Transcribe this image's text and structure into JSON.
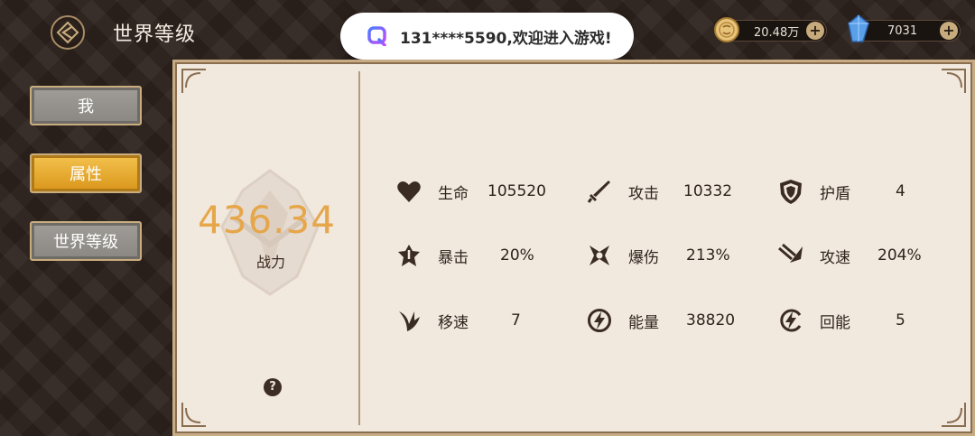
{
  "header": {
    "title": "世界等级",
    "toast_message": "131****5590,欢迎进入游戏!",
    "gold": "20.48万",
    "gems": "7031"
  },
  "sidebar": {
    "items": [
      {
        "label": "我",
        "active": false
      },
      {
        "label": "属性",
        "active": true
      },
      {
        "label": "世界等级",
        "active": false
      }
    ]
  },
  "power": {
    "value": "436.34",
    "label": "战力"
  },
  "stats": [
    {
      "icon": "heart-icon",
      "label": "生命",
      "value": "105520"
    },
    {
      "icon": "sword-icon",
      "label": "攻击",
      "value": "10332"
    },
    {
      "icon": "shield-icon",
      "label": "护盾",
      "value": "4"
    },
    {
      "icon": "crit-icon",
      "label": "暴击",
      "value": "20%"
    },
    {
      "icon": "crit-damage-icon",
      "label": "爆伤",
      "value": "213%"
    },
    {
      "icon": "attack-speed-icon",
      "label": "攻速",
      "value": "204%"
    },
    {
      "icon": "wing-icon",
      "label": "移速",
      "value": "7"
    },
    {
      "icon": "energy-icon",
      "label": "能量",
      "value": "38820"
    },
    {
      "icon": "energy-regen-icon",
      "label": "回能",
      "value": "5"
    }
  ],
  "colors": {
    "accent_gold": "#e6a64a",
    "panel_bg": "#f1e8de",
    "active_tab": "#f4c24e"
  }
}
